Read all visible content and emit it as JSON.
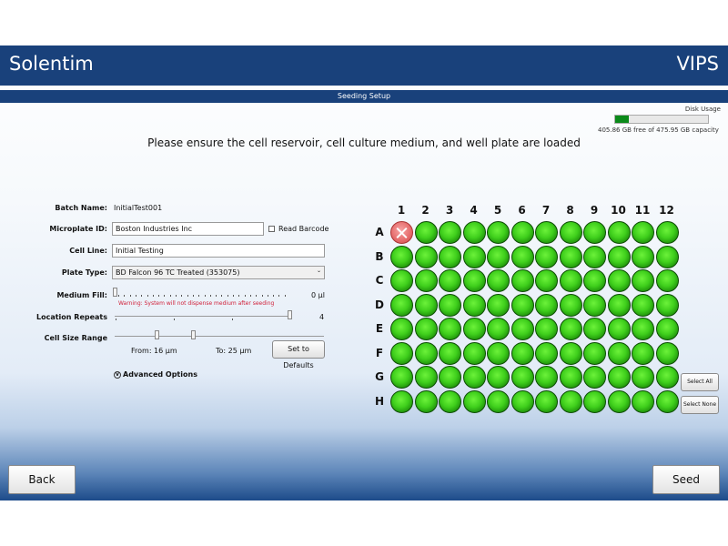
{
  "header": {
    "brand": "Solentim",
    "product": "VIPS"
  },
  "subbar": {
    "title": "Seeding Setup"
  },
  "disk": {
    "label": "Disk Usage",
    "free_text": "405.86 GB free of 475.95 GB capacity",
    "used_fraction": 0.147
  },
  "instruction": "Please ensure the cell reservoir, cell culture medium, and well plate are loaded",
  "form": {
    "batch_name_label": "Batch Name:",
    "batch_name_value": "InitialTest001",
    "microplate_label": "Microplate ID:",
    "microplate_value": "Boston Industries Inc",
    "read_barcode_label": "Read Barcode",
    "cell_line_label": "Cell Line:",
    "cell_line_value": "Initial Testing",
    "plate_type_label": "Plate Type:",
    "plate_type_value": "BD Falcon 96 TC Treated (353075)",
    "medium_fill_label": "Medium Fill:",
    "medium_fill_value": "0 µl",
    "medium_fill_warning": "Warning: System will not dispense medium after seeding",
    "location_repeats_label": "Location Repeats",
    "location_repeats_value": "4",
    "cell_size_label": "Cell Size Range",
    "from_label": "From: 16  µm",
    "to_label": "To: 25  µm",
    "defaults_button": "Set to Defaults",
    "advanced_label": "Advanced Options"
  },
  "plate": {
    "columns": [
      "1",
      "2",
      "3",
      "4",
      "5",
      "6",
      "7",
      "8",
      "9",
      "10",
      "11",
      "12"
    ],
    "rows": [
      "A",
      "B",
      "C",
      "D",
      "E",
      "F",
      "G",
      "H"
    ],
    "excluded_wells": [
      "A1"
    ],
    "colors": {
      "selected": "#3fcf1c",
      "excluded": "#e56a6a"
    }
  },
  "side_buttons": {
    "select_all": "Select All",
    "select_none": "Select None"
  },
  "footer": {
    "back": "Back",
    "seed": "Seed"
  }
}
